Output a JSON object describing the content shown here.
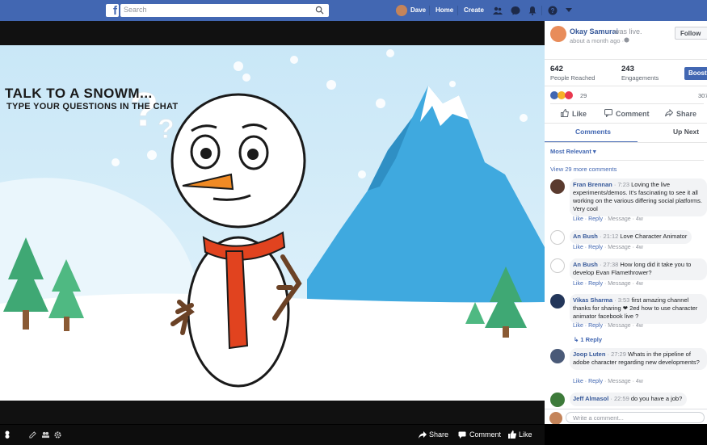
{
  "topbar": {
    "logo": "f",
    "search_placeholder": "Search",
    "user": "Dave",
    "home": "Home",
    "create": "Create",
    "icons": [
      "friends-icon",
      "messenger-icon",
      "notifications-icon",
      "help-icon",
      "caret-down-icon"
    ],
    "color": "#4267b2"
  },
  "video": {
    "title": "TALK TO A SNOWM...",
    "subtitle": "TYPE YOUR QUESTIONS IN THE CHAT",
    "share": "Share",
    "comment": "Comment",
    "like": "Like"
  },
  "panel": {
    "page_name": "Okay Samurai",
    "live_text": "was live.",
    "time": "about a month ago ·",
    "follow": "Follow",
    "stats": [
      {
        "value": "642",
        "label": "People Reached"
      },
      {
        "value": "243",
        "label": "Engagements"
      }
    ],
    "boost": "Boost",
    "reaction_count": "29",
    "reaction_right": "307",
    "actions": {
      "like": "Like",
      "comment": "Comment",
      "share": "Share"
    },
    "tabs": {
      "comments": "Comments",
      "up_next": "Up Next"
    },
    "sort": "Most Relevant ▾",
    "view_more": "View 29 more comments",
    "comments": [
      {
        "name": "Fran Brennan",
        "time": "· 7:23",
        "text": "Loving the live experiments/demos. It's fascinating to see it all working on the various differing social platforms. Very cool",
        "meta": "4w"
      },
      {
        "name": "An Bush",
        "time": "· 21:12",
        "text": "Love Character Animator",
        "meta": "4w"
      },
      {
        "name": "An Bush",
        "time": "· 27:38",
        "text": "How long did it take you to develop Evan Flamethrower?",
        "meta": "4w"
      },
      {
        "name": "Vikas Sharma",
        "time": "· 3:53",
        "text": "first amazing channel thanks for sharing ❤ 2ed how to use character animator facebook live ?",
        "meta": "4w",
        "replies": "1 Reply"
      },
      {
        "name": "Joop Luten",
        "time": "· 27:29",
        "text": "Whats in the pipeline of adobe character regarding new developments?",
        "meta": "4w"
      },
      {
        "name": "Jeff Almasol",
        "time": "· 22:59",
        "text": "do you have a job?",
        "meta": ""
      }
    ],
    "comment_actions": {
      "like": "Like",
      "reply": "Reply",
      "message": "Message"
    },
    "write_placeholder": "Write a comment..."
  }
}
